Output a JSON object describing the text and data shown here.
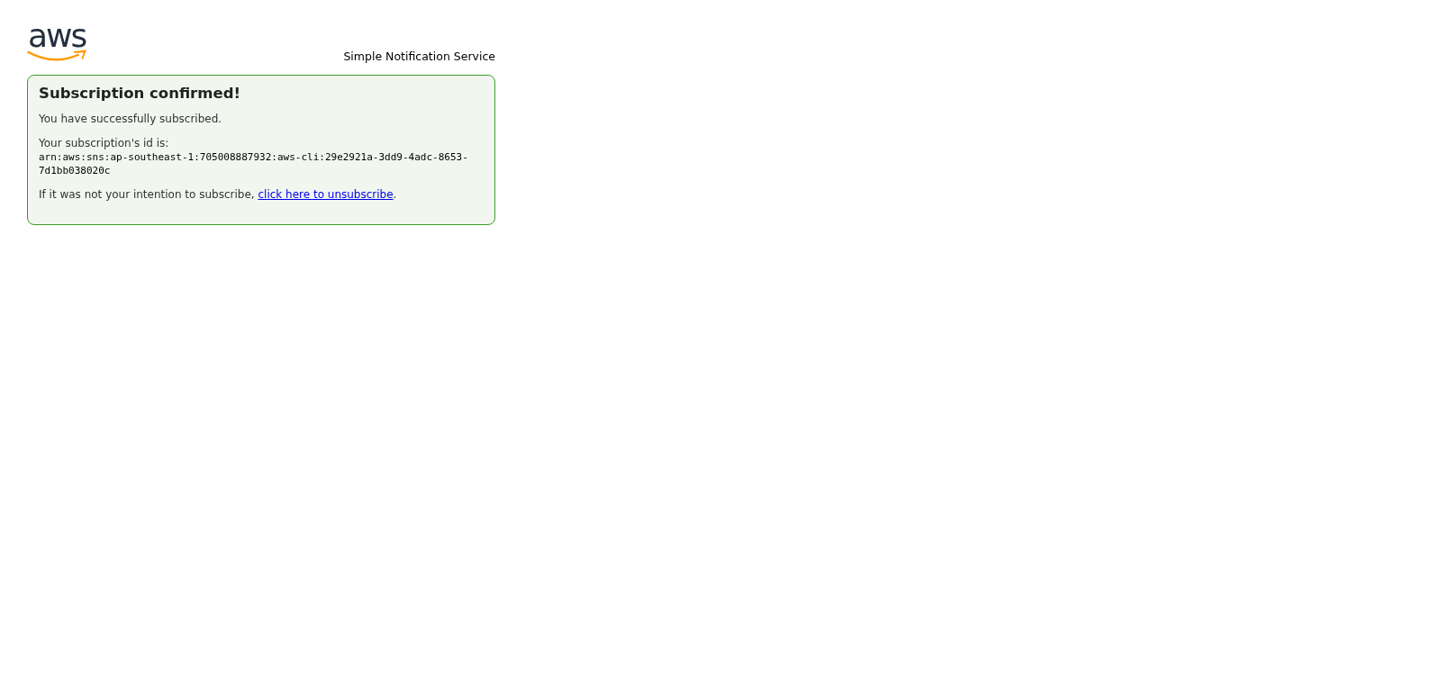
{
  "header": {
    "logo": {
      "wordmark": "aws"
    },
    "service": "Simple Notification Service"
  },
  "message": {
    "title": "Subscription confirmed!",
    "paragraphs": [
      {
        "kind": "text",
        "text": "You have successfully subscribed."
      },
      {
        "kind": "id",
        "label": "Your subscription's id is:",
        "value": "arn:aws:sns:ap-southeast-1:705008887932:aws-cli:29e2921a-3dd9-4adc-8653-7d1bb038020c"
      },
      {
        "kind": "link",
        "text": "If it was not your intention to subscribe, ",
        "link": "click here to unsubscribe",
        "after": "."
      }
    ]
  }
}
